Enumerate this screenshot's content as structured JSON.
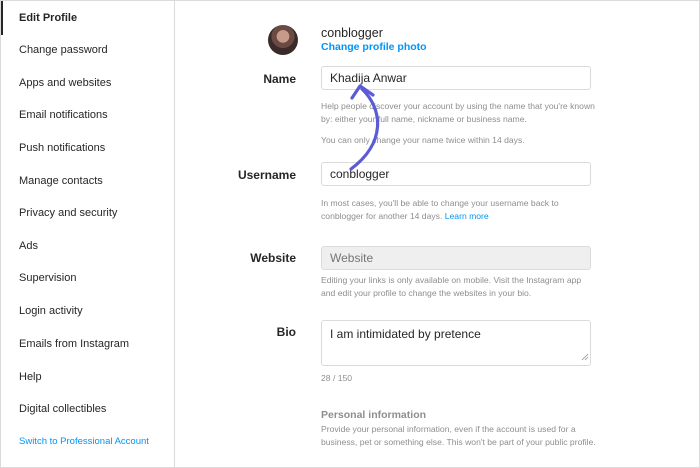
{
  "sidebar": {
    "items": [
      {
        "label": "Edit Profile",
        "active": true
      },
      {
        "label": "Change password"
      },
      {
        "label": "Apps and websites"
      },
      {
        "label": "Email notifications"
      },
      {
        "label": "Push notifications"
      },
      {
        "label": "Manage contacts"
      },
      {
        "label": "Privacy and security"
      },
      {
        "label": "Ads"
      },
      {
        "label": "Supervision"
      },
      {
        "label": "Login activity"
      },
      {
        "label": "Emails from Instagram"
      },
      {
        "label": "Help"
      },
      {
        "label": "Digital collectibles"
      },
      {
        "label": "Switch to Professional Account"
      }
    ]
  },
  "profile": {
    "username": "conblogger",
    "change_photo": "Change profile photo"
  },
  "form": {
    "name": {
      "label": "Name",
      "value": "Khadija Anwar",
      "help1": "Help people discover your account by using the name that you're known by: either your full name, nickname or business name.",
      "help2": "You can only change your name twice within 14 days."
    },
    "username": {
      "label": "Username",
      "value": "conblogger",
      "help": "In most cases, you'll be able to change your username back to conblogger for another 14 days.",
      "help_link": "Learn more"
    },
    "website": {
      "label": "Website",
      "placeholder": "Website",
      "help": "Editing your links is only available on mobile. Visit the Instagram app and edit your profile to change the websites in your bio."
    },
    "bio": {
      "label": "Bio",
      "value": "I am intimidated by pretence",
      "counter": "28 / 150"
    },
    "personal": {
      "title": "Personal information",
      "help": "Provide your personal information, even if the account is used for a business, pet or something else. This won't be part of your public profile."
    }
  },
  "colors": {
    "accent": "#0095f6",
    "annotation_arrow": "#5b5bd6",
    "border": "#dbdbdb",
    "muted_text": "#8e8e8e"
  }
}
